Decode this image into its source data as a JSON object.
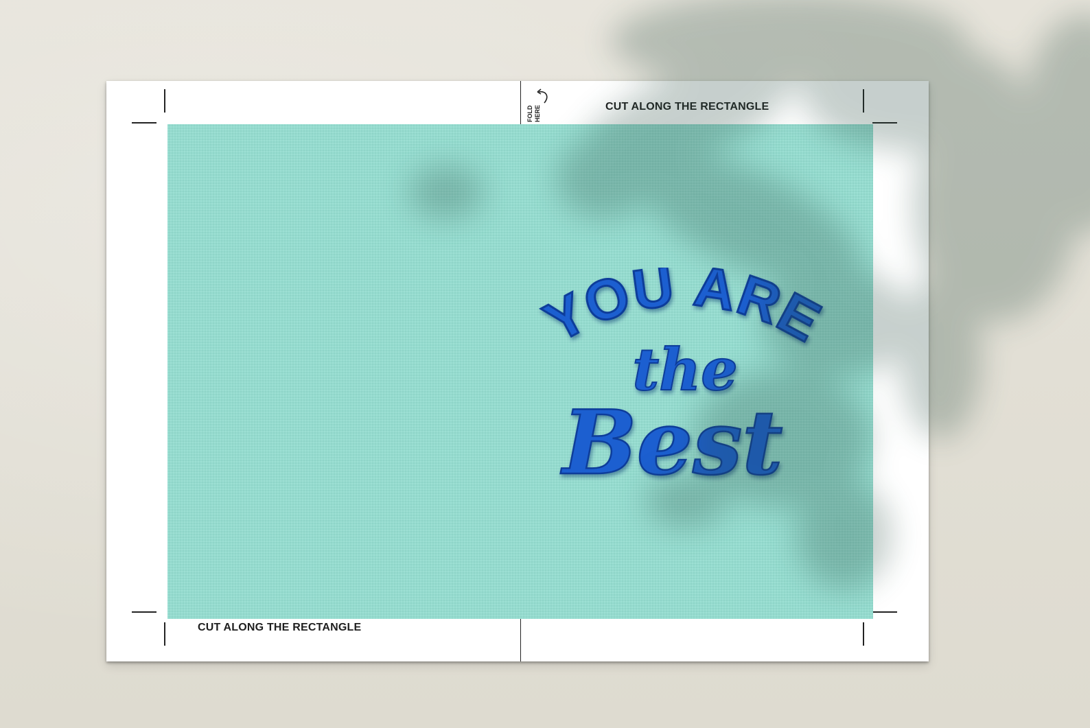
{
  "sheet": {
    "cut_label_top": "CUT ALONG THE RECTANGLE",
    "cut_label_bottom": "CUT ALONG THE RECTANGLE",
    "fold_label": "FOLD HERE"
  },
  "card": {
    "background_color": "#94ddd0",
    "lettering_color": "#1f5fd0",
    "lettering_line1": "YOU ARE",
    "lettering_line2": "the",
    "lettering_line3": "Best"
  }
}
